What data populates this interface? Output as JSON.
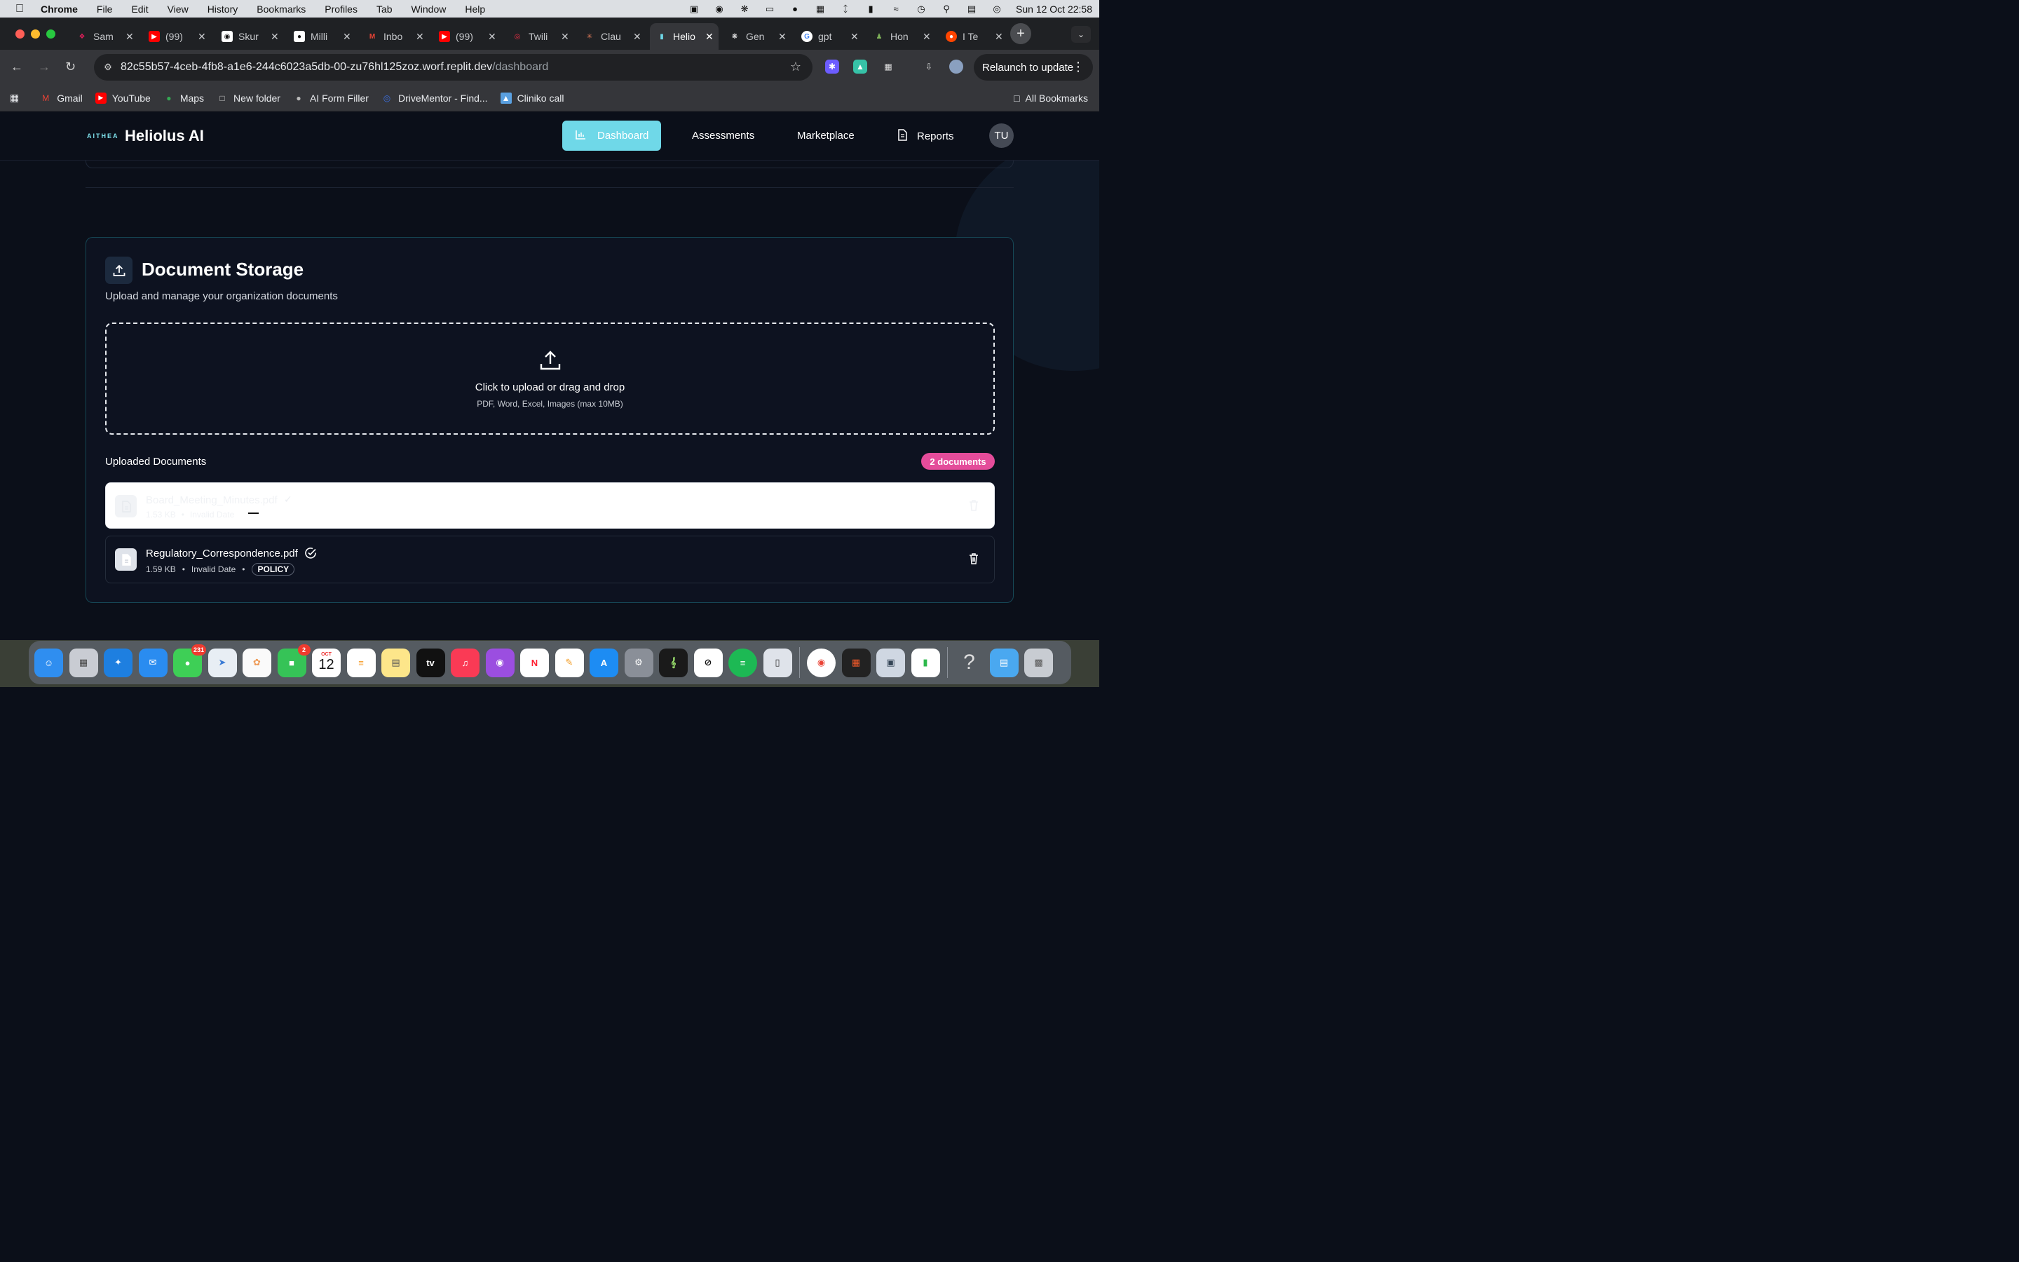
{
  "menubar": {
    "app": "Chrome",
    "items": [
      "File",
      "Edit",
      "View",
      "History",
      "Bookmarks",
      "Profiles",
      "Tab",
      "Window",
      "Help"
    ],
    "datetime": "Sun 12 Oct  22:58"
  },
  "tabs": [
    {
      "title": "Sam",
      "icon": "slack-icon",
      "color": "#e01e5a"
    },
    {
      "title": "(99)",
      "icon": "youtube-icon",
      "color": "#ff0000"
    },
    {
      "title": "Skur",
      "icon": "skool-icon",
      "color": "#ffffff"
    },
    {
      "title": "Milli",
      "icon": "milli-icon",
      "color": "#ffffff"
    },
    {
      "title": "Inbo",
      "icon": "gmail-icon",
      "color": "#ea4335"
    },
    {
      "title": "(99)",
      "icon": "youtube-icon",
      "color": "#ff0000"
    },
    {
      "title": "Twili",
      "icon": "twilio-icon",
      "color": "#f22f46"
    },
    {
      "title": "Clau",
      "icon": "claude-icon",
      "color": "#d97757"
    },
    {
      "title": "Helio",
      "icon": "heliolus-icon",
      "color": "#6fd8e8"
    },
    {
      "title": "Gen",
      "icon": "openai-icon",
      "color": "#ffffff"
    },
    {
      "title": "gpt",
      "icon": "google-icon",
      "color": "#4285f4"
    },
    {
      "title": "Hon",
      "icon": "hon-icon",
      "color": "#7fb35a"
    },
    {
      "title": "I Te",
      "icon": "reddit-icon",
      "color": "#ff4500"
    }
  ],
  "browser": {
    "url_main": "82c55b57-4ceb-4fb8-a1e6-244c6023a5db-00-zu76hl125zoz.worf.replit.dev",
    "url_path": "/dashboard",
    "relaunch": "Relaunch to update"
  },
  "bookmarks": [
    {
      "label": "Gmail",
      "icon": "gmail-icon"
    },
    {
      "label": "YouTube",
      "icon": "youtube-icon"
    },
    {
      "label": "Maps",
      "icon": "maps-icon"
    },
    {
      "label": "New folder",
      "icon": "folder-icon"
    },
    {
      "label": "AI Form Filler",
      "icon": "globe-icon"
    },
    {
      "label": "DriveMentor - Find...",
      "icon": "steering-icon"
    },
    {
      "label": "Cliniko call",
      "icon": "cliniko-icon"
    }
  ],
  "all_bookmarks": "All Bookmarks",
  "app": {
    "logo_text": "AITHEA",
    "brand": "Heliolus AI",
    "nav": {
      "dashboard": "Dashboard",
      "assessments": "Assessments",
      "marketplace": "Marketplace",
      "reports": "Reports"
    },
    "avatar": "TU"
  },
  "storage": {
    "title": "Document Storage",
    "subtitle": "Upload and manage your organization documents",
    "drop_title": "Click to upload or drag and drop",
    "drop_hint": "PDF, Word, Excel, Images (max 10MB)",
    "uploaded_heading": "Uploaded Documents",
    "count_badge": "2 documents",
    "documents": [
      {
        "name": "Board_Meeting_Minutes.pdf",
        "size": "1.53 KB",
        "date": "Invalid Date",
        "tag": ""
      },
      {
        "name": "Regulatory_Correspondence.pdf",
        "size": "1.59 KB",
        "date": "Invalid Date",
        "tag": "POLICY"
      }
    ]
  },
  "dock": {
    "apps": [
      "finder",
      "launchpad",
      "safari",
      "mail",
      "messages",
      "maps",
      "photos",
      "facetime",
      "calendar",
      "reminders",
      "notes",
      "tv",
      "music",
      "podcasts",
      "news",
      "pages",
      "app-store",
      "system-settings",
      "musescore",
      "capcut",
      "spotify",
      "iphone-mirroring",
      "chrome",
      "setapp",
      "preview",
      "numbers",
      "help",
      "files",
      "trash"
    ],
    "messages_badge": "231",
    "facetime_badge": "2",
    "calendar_month": "OCT",
    "calendar_day": "12",
    "tv_label": "tv"
  },
  "colors": {
    "accent": "#6fd8e8",
    "badge": "#e44c9a",
    "card_border": "#164856",
    "page_bg": "#0b0f19"
  }
}
